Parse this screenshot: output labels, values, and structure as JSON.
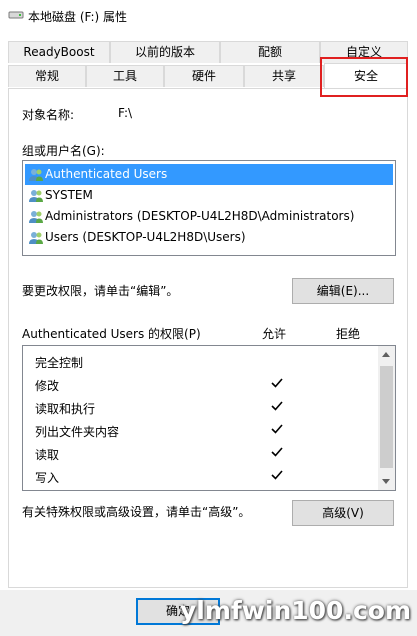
{
  "window": {
    "title": "本地磁盘 (F:) 属性"
  },
  "tabs_row1": [
    "ReadyBoost",
    "以前的版本",
    "配额",
    "自定义"
  ],
  "tabs_row2": [
    "常规",
    "工具",
    "硬件",
    "共享",
    "安全"
  ],
  "object": {
    "label": "对象名称:",
    "value": "F:\\"
  },
  "groups": {
    "label": "组或用户名(G):",
    "items": [
      "Authenticated Users",
      "SYSTEM",
      "Administrators (DESKTOP-U4L2H8D\\Administrators)",
      "Users (DESKTOP-U4L2H8D\\Users)"
    ],
    "selected_index": 0
  },
  "edit": {
    "hint": "要更改权限，请单击“编辑”。",
    "button": "编辑(E)..."
  },
  "permissions": {
    "label": "Authenticated Users 的权限(P)",
    "allow_header": "允许",
    "deny_header": "拒绝",
    "rows": [
      {
        "name": "完全控制",
        "allow": false,
        "deny": false
      },
      {
        "name": "修改",
        "allow": true,
        "deny": false
      },
      {
        "name": "读取和执行",
        "allow": true,
        "deny": false
      },
      {
        "name": "列出文件夹内容",
        "allow": true,
        "deny": false
      },
      {
        "name": "读取",
        "allow": true,
        "deny": false
      },
      {
        "name": "写入",
        "allow": true,
        "deny": false
      }
    ]
  },
  "advanced": {
    "hint": "有关特殊权限或高级设置，请单击“高级”。",
    "button": "高级(V)"
  },
  "footer": {
    "ok_button": "确定"
  },
  "watermark": "ylmfwin100.com",
  "colors": {
    "selection": "#3399ff",
    "highlight_box": "#e02020",
    "default_button_border": "#0078d7"
  }
}
